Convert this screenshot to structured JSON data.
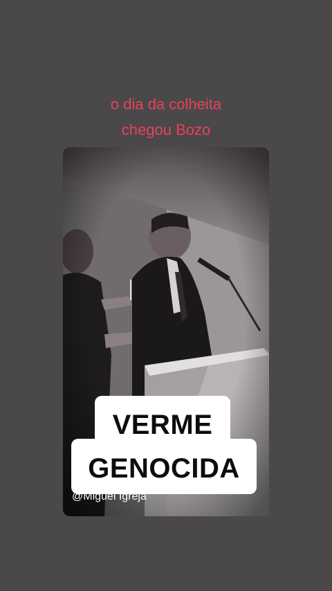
{
  "caption": {
    "line1": "o dia da colheita",
    "line2": "chegou Bozo",
    "color": "#e8425a"
  },
  "video": {
    "overlay_line1": "VERME",
    "overlay_line2": "GENOCIDA",
    "watermark": "@Miguel Igreja"
  }
}
